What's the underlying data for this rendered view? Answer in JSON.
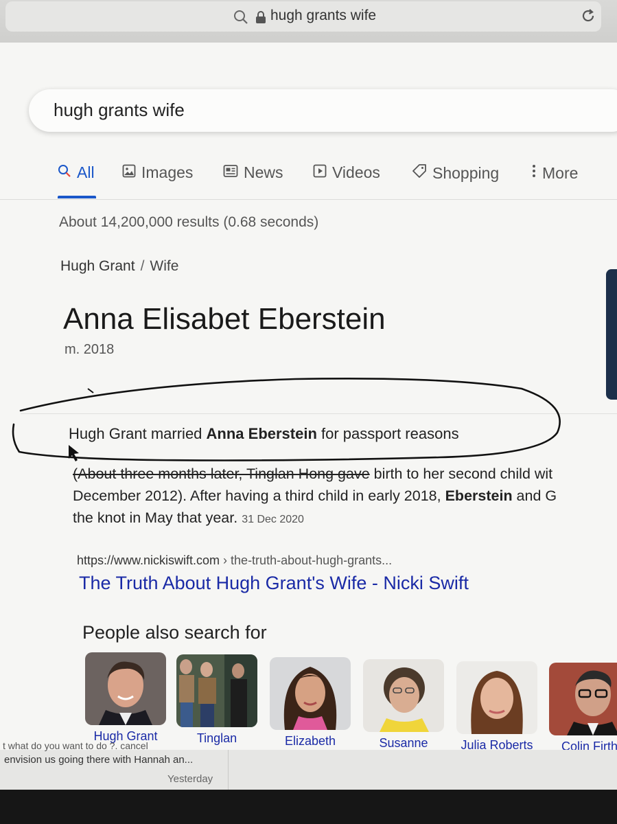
{
  "browser": {
    "url_text": "hugh grants wife"
  },
  "search": {
    "query": "hugh grants wife"
  },
  "tabs": [
    {
      "label": "All",
      "icon": "search-icon",
      "active": true
    },
    {
      "label": "Images",
      "icon": "image-icon"
    },
    {
      "label": "News",
      "icon": "news-icon"
    },
    {
      "label": "Videos",
      "icon": "video-icon"
    },
    {
      "label": "Shopping",
      "icon": "tag-icon"
    },
    {
      "label": "More",
      "icon": "more-vertical-icon"
    }
  ],
  "results_stats": "About 14,200,000 results (0.68 seconds)",
  "answer": {
    "breadcrumb_subject": "Hugh Grant",
    "breadcrumb_separator": "/",
    "breadcrumb_attribute": "Wife",
    "title": "Anna Elisabet Eberstein",
    "subtitle": "m. 2018"
  },
  "featured_snippet": {
    "prefix": "Hugh Grant married ",
    "bold": "Anna Eberstein",
    "suffix": " for passport reasons",
    "line1_strike": "(About three months later, Tinglan Hong gave",
    "line1_rest": " birth to her second child wit",
    "line2_pre": "December 2012). After having a third child in early 2018, ",
    "line2_bold": "Eberstein",
    "line2_post": " and G",
    "line3": "the knot in May that year.",
    "date": "31 Dec 2020"
  },
  "result": {
    "domain": "https://www.nickiswift.com",
    "path": " › the-truth-about-hugh-grants...",
    "title": "The Truth About Hugh Grant's Wife - Nicki Swift"
  },
  "people_also_search": {
    "heading": "People also search for",
    "items": [
      {
        "name": "Hugh Grant"
      },
      {
        "name": "Tinglan"
      },
      {
        "name": "Elizabeth"
      },
      {
        "name": "Susanne"
      },
      {
        "name": "Julia Roberts"
      },
      {
        "name": "Colin Firth"
      }
    ]
  },
  "bottom_app": {
    "preview_cut": "t what do you want to do ?. cancel",
    "preview": "envision us going there with Hannah an...",
    "time": "Yesterday"
  },
  "colors": {
    "accent": "#1a57c9",
    "link": "#1a2aa6",
    "background": "#f6f6f4"
  }
}
